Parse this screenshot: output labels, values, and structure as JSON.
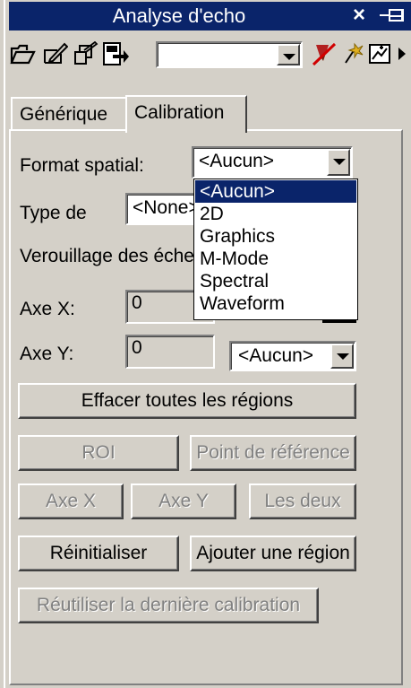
{
  "window": {
    "title": "Analyse d'echo",
    "close_glyph": "×"
  },
  "toolbar": {
    "icons": [
      "open-folder-icon",
      "edit-icon",
      "copy-icon",
      "export-icon",
      "erase-icon",
      "wizard-icon",
      "chart-icon",
      "more-arrow-icon"
    ],
    "combo_value": ""
  },
  "tabs": [
    {
      "label": "Générique",
      "active": false
    },
    {
      "label": "Calibration",
      "active": true
    }
  ],
  "form": {
    "format_label": "Format spatial:",
    "format_value": "<Aucun>",
    "type_label": "Type de",
    "type_value": "<None>",
    "lock_label": "Verouillage des échelles",
    "axe_x_label": "Axe X:",
    "axe_x_value": "0",
    "axe_y_label": "Axe Y:",
    "axe_y_value": "0",
    "axe_y_unit": "<Aucun>"
  },
  "dropdown": {
    "options": [
      "<Aucun>",
      "2D",
      "Graphics",
      "M-Mode",
      "Spectral",
      "Waveform"
    ],
    "selected_index": 0
  },
  "buttons": {
    "clear_all": "Effacer toutes les régions",
    "roi": "ROI",
    "ref_point": "Point de référence",
    "axe_x": "Axe X",
    "axe_y": "Axe Y",
    "both": "Les deux",
    "reset": "Réinitialiser",
    "add_region": "Ajouter une région",
    "reuse_calibration": "Réutiliser la dernière calibration"
  },
  "colors": {
    "titlebar": "#0a246a",
    "face": "#d4d0c8",
    "selection": "#0a246a"
  }
}
